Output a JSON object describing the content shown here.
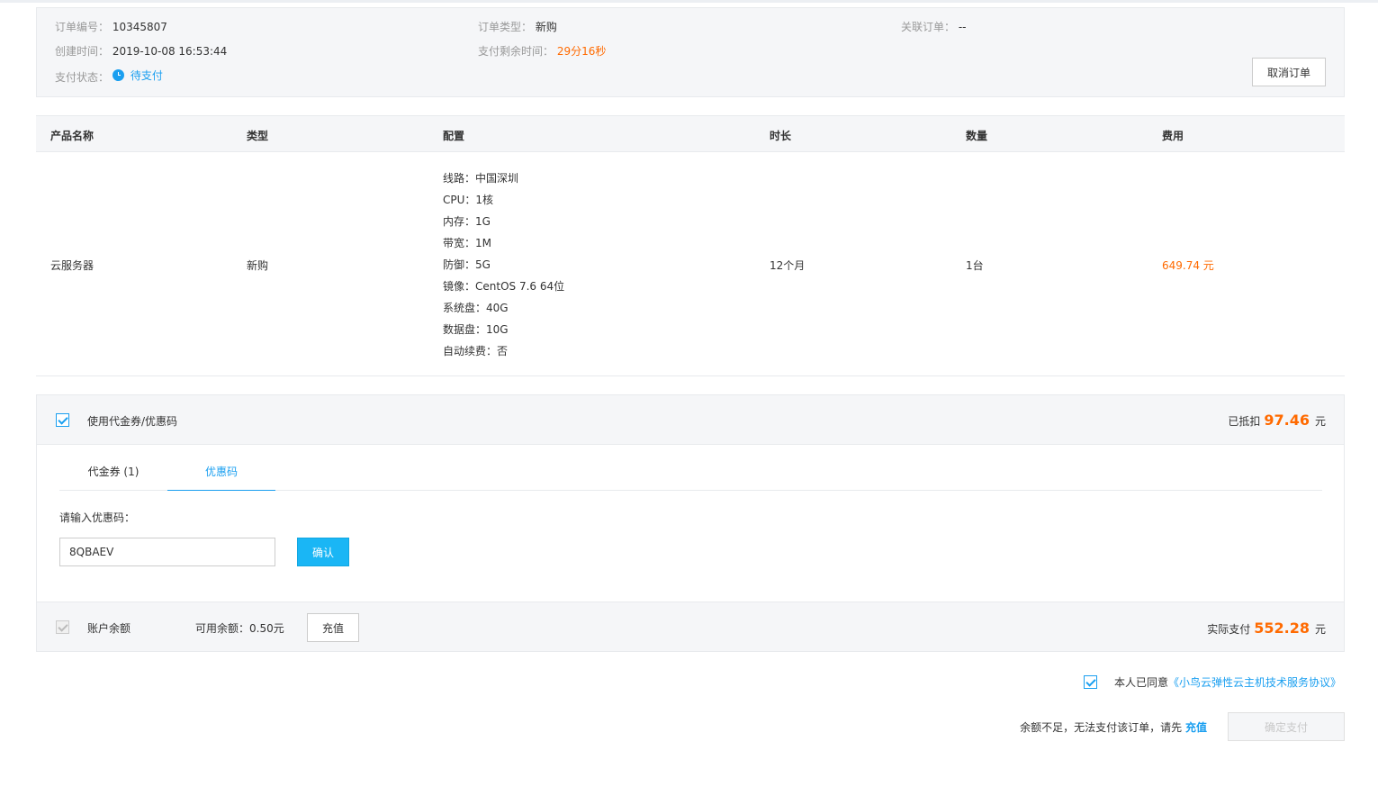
{
  "order": {
    "order_no_label": "订单编号：",
    "order_no": "10345807",
    "created_label": "创建时间：",
    "created": "2019-10-08 16:53:44",
    "status_label": "支付状态：",
    "status": "待支付",
    "type_label": "订单类型：",
    "type": "新购",
    "remaining_label": "支付剩余时间：",
    "remaining": "29分16秒",
    "related_label": "关联订单：",
    "related": "--",
    "cancel_label": "取消订单",
    "status_color": "#1a9ff0"
  },
  "table": {
    "headers": [
      "产品名称",
      "类型",
      "配置",
      "时长",
      "数量",
      "费用"
    ],
    "row": {
      "name": "云服务器",
      "type": "新购",
      "config": [
        "线路：中国深圳",
        "CPU：1核",
        "内存：1G",
        "带宽：1M",
        "防御：5G",
        "镜像：CentOS 7.6 64位",
        "系统盘：40G",
        "数据盘：10G",
        "自动续费：否"
      ],
      "duration": "12个月",
      "quantity": "1台",
      "fee": "649.74 元"
    }
  },
  "coupon": {
    "use_label": "使用代金券/优惠码",
    "deducted_label": "已抵扣",
    "deducted_amount": "97.46",
    "unit": "元",
    "tabs": [
      "代金券 (1)",
      "优惠码"
    ],
    "active_tab": 1,
    "code_label": "请输入优惠码：",
    "code_value": "8QBAEV",
    "confirm_label": "确认"
  },
  "balance": {
    "label": "账户余额",
    "available": "可用余额：0.50元",
    "recharge_label": "充值",
    "actual_label": "实际支付",
    "actual_amount": "552.28",
    "unit": "元"
  },
  "agreement": {
    "text": "本人已同意",
    "link": "《小鸟云弹性云主机技术服务协议》"
  },
  "footer": {
    "insufficient_text": "余额不足，无法支付该订单，请先",
    "recharge_link": "充值",
    "pay_label": "确定支付"
  },
  "colors": {
    "accent": "#1a9ff0",
    "price": "#ff6a00",
    "panel_bg": "#f5f6f8"
  }
}
